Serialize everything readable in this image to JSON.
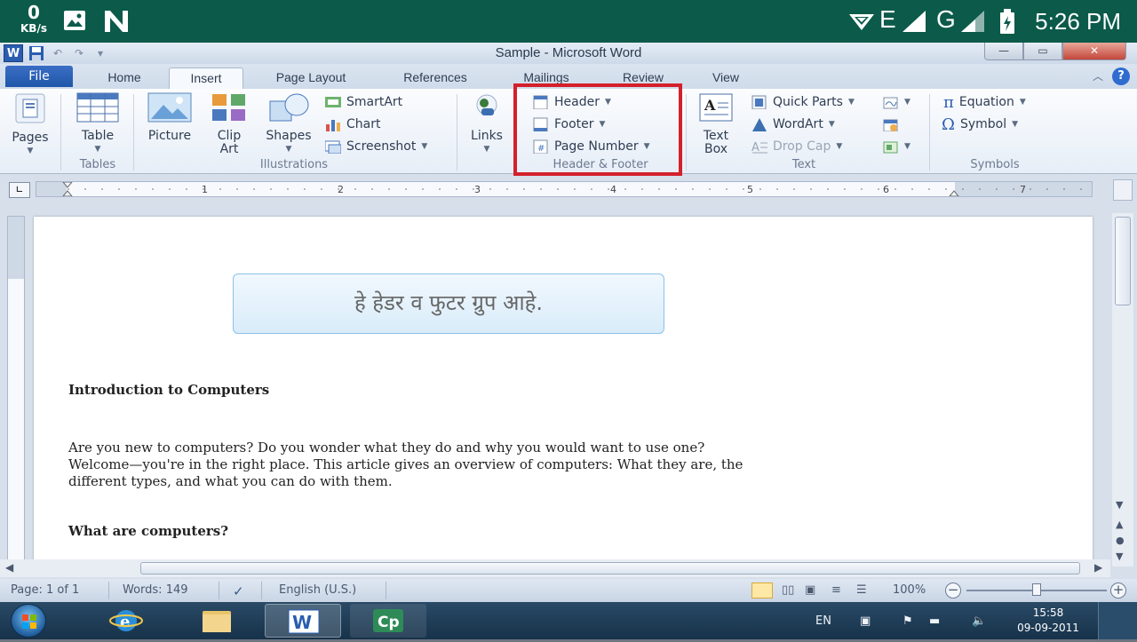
{
  "android_status": {
    "data_speed": "0",
    "data_unit": "KB/s",
    "network_e": "E",
    "network_g": "G",
    "time": "5:26 PM"
  },
  "window": {
    "title": "Sample  -  Microsoft Word",
    "app_icon_letter": "W"
  },
  "tabs": {
    "file": "File",
    "items": [
      "Home",
      "Insert",
      "Page Layout",
      "References",
      "Mailings",
      "Review",
      "View"
    ],
    "active": "Insert"
  },
  "ribbon": {
    "pages": {
      "label": "Pages"
    },
    "tables": {
      "button": "Table",
      "group": "Tables"
    },
    "illustrations": {
      "picture": "Picture",
      "clip_art_1": "Clip",
      "clip_art_2": "Art",
      "shapes": "Shapes",
      "smartart": "SmartArt",
      "chart": "Chart",
      "screenshot": "Screenshot",
      "group": "Illustrations"
    },
    "links": {
      "button": "Links"
    },
    "header_footer": {
      "header": "Header",
      "footer": "Footer",
      "page_number": "Page Number",
      "group": "Header & Footer"
    },
    "text": {
      "text_box_1": "Text",
      "text_box_2": "Box",
      "quick_parts": "Quick Parts",
      "wordart": "WordArt",
      "drop_cap": "Drop Cap",
      "group": "Text"
    },
    "symbols": {
      "equation": "Equation",
      "symbol": "Symbol",
      "group": "Symbols"
    }
  },
  "ruler": {
    "numbers": [
      "1",
      "2",
      "3",
      "4",
      "5",
      "6",
      "7"
    ]
  },
  "document": {
    "callout": "हे हेडर व फुटर ग्रुप आहे.",
    "heading1": "Introduction to Computers",
    "para1_line1": "Are you new to computers? Do you wonder what they do and why you would want to use one?",
    "para1_line2": "Welcome—you're in the right place. This article gives an overview of computers: What they are, the",
    "para1_line3": "different types, and what you can do with them.",
    "heading2": "What are computers?"
  },
  "statusbar": {
    "page": "Page: 1 of 1",
    "words": "Words: 149",
    "language": "English (U.S.)",
    "zoom": "100%",
    "zoom_level": 100
  },
  "taskbar": {
    "lang": "EN",
    "time": "15:58",
    "date": "09-09-2011"
  },
  "colors": {
    "highlight": "#d4202a",
    "android_bar": "#0b5a4a",
    "file_tab": "#1f56a9"
  }
}
